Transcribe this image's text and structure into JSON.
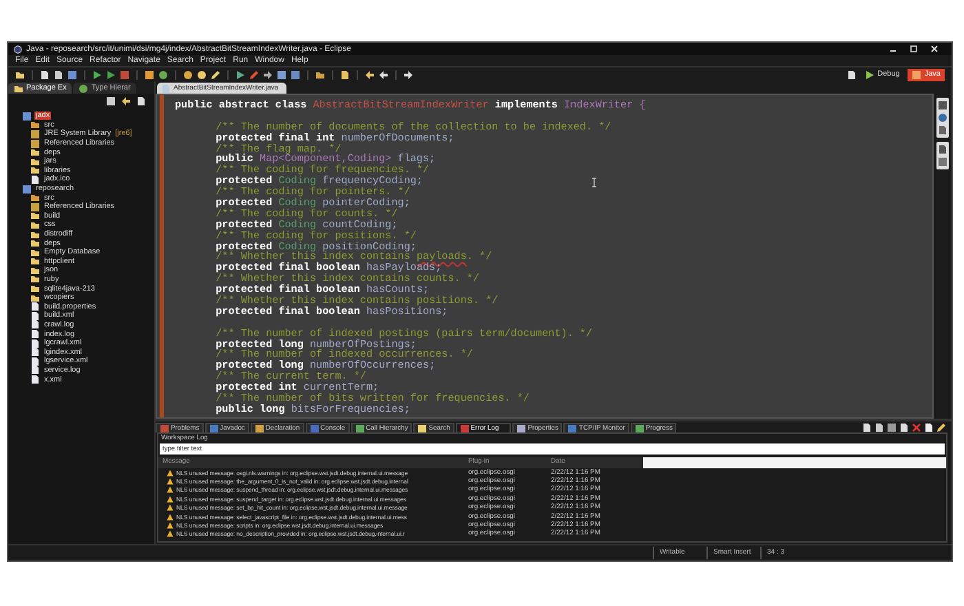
{
  "window": {
    "title": "Java - reposearch/src/it/unimi/dsi/mg4j/index/AbstractBitStreamIndexWriter.java - Eclipse"
  },
  "menu": [
    "File",
    "Edit",
    "Source",
    "Refactor",
    "Navigate",
    "Search",
    "Project",
    "Run",
    "Window",
    "Help"
  ],
  "perspectives": [
    {
      "label": "Debug",
      "selected": false
    },
    {
      "label": "Java",
      "selected": true
    }
  ],
  "left_tabs": [
    {
      "label": "Package Ex",
      "selected": true
    },
    {
      "label": "Type Hierar",
      "selected": false
    }
  ],
  "package_explorer": {
    "tree": [
      {
        "label": "jadx",
        "kind": "project",
        "selected": true,
        "children": [
          {
            "label": "src",
            "kind": "source",
            "selected": false
          },
          {
            "label": "JRE System Library",
            "decoration": "[jre6]",
            "kind": "library",
            "selected": false
          },
          {
            "label": "Referenced Libraries",
            "kind": "library",
            "selected": false
          },
          {
            "label": "deps",
            "kind": "folder",
            "selected": false
          },
          {
            "label": "jars",
            "kind": "folder",
            "selected": false
          },
          {
            "label": "libraries",
            "kind": "folder",
            "selected": false
          },
          {
            "label": "jadx.ico",
            "kind": "file",
            "selected": false
          }
        ]
      },
      {
        "label": "reposearch",
        "kind": "project",
        "selected": false,
        "children": [
          {
            "label": "src",
            "kind": "source",
            "selected": false
          },
          {
            "label": "Referenced Libraries",
            "kind": "library",
            "selected": false
          },
          {
            "label": "build",
            "kind": "folder",
            "selected": false
          },
          {
            "label": "css",
            "kind": "folder",
            "selected": false
          },
          {
            "label": "distrodiff",
            "kind": "folder",
            "selected": false
          },
          {
            "label": "deps",
            "kind": "folder",
            "selected": false
          },
          {
            "label": "Empty Database",
            "kind": "folder",
            "selected": false
          },
          {
            "label": "httpclient",
            "kind": "folder",
            "selected": false
          },
          {
            "label": "json",
            "kind": "folder",
            "selected": false
          },
          {
            "label": "ruby",
            "kind": "folder",
            "selected": false
          },
          {
            "label": "sqlite4java-213",
            "kind": "folder",
            "selected": false
          },
          {
            "label": "wcopiers",
            "kind": "folder",
            "selected": false
          },
          {
            "label": "build.properties",
            "kind": "file",
            "selected": false
          },
          {
            "label": "build.xml",
            "kind": "file",
            "selected": false
          },
          {
            "label": "crawl.log",
            "kind": "file",
            "selected": false
          },
          {
            "label": "index.log",
            "kind": "file",
            "selected": false
          },
          {
            "label": "lgcrawl.xml",
            "kind": "file",
            "selected": false
          },
          {
            "label": "lgindex.xml",
            "kind": "file",
            "selected": false
          },
          {
            "label": "lgservice.xml",
            "kind": "file",
            "selected": false
          },
          {
            "label": "service.log",
            "kind": "file",
            "selected": false
          },
          {
            "label": "x.xml",
            "kind": "file",
            "selected": false
          }
        ]
      }
    ]
  },
  "editor": {
    "tab": "AbstractBitStreamIndexWriter.java",
    "header": [
      {
        "kind": "keyword",
        "text": "public abstract class"
      },
      {
        "kind": "class",
        "text": "AbstractBitStreamIndexWriter"
      },
      {
        "kind": "keyword",
        "text": "implements"
      },
      {
        "kind": "generic",
        "text": "IndexWriter {"
      }
    ],
    "body": [
      {
        "kind": "code",
        "segments": [
          {
            "kind": "comment",
            "text": "/** The number of documents of the collection to be indexed. */"
          }
        ]
      },
      {
        "kind": "code",
        "segments": [
          {
            "kind": "keyword",
            "text": "protected final int"
          },
          {
            "kind": "field",
            "text": "numberOfDocuments;"
          }
        ]
      },
      {
        "kind": "code",
        "segments": [
          {
            "kind": "comment",
            "text": "/** The flag map. */"
          }
        ]
      },
      {
        "kind": "code",
        "segments": [
          {
            "kind": "keyword",
            "text": "public"
          },
          {
            "kind": "generic",
            "text": "Map<Component,Coding>"
          },
          {
            "kind": "field",
            "text": "flags;"
          }
        ]
      },
      {
        "kind": "code",
        "segments": [
          {
            "kind": "comment",
            "text": "/** The coding for frequencies. */"
          }
        ]
      },
      {
        "kind": "code",
        "segments": [
          {
            "kind": "keyword",
            "text": "protected"
          },
          {
            "kind": "type",
            "text": "Coding"
          },
          {
            "kind": "field",
            "text": "frequencyCoding;"
          }
        ]
      },
      {
        "kind": "code",
        "segments": [
          {
            "kind": "comment",
            "text": "/** The coding for pointers. */"
          }
        ]
      },
      {
        "kind": "code",
        "segments": [
          {
            "kind": "keyword",
            "text": "protected"
          },
          {
            "kind": "type",
            "text": "Coding"
          },
          {
            "kind": "field",
            "text": "pointerCoding;"
          }
        ]
      },
      {
        "kind": "code",
        "segments": [
          {
            "kind": "comment",
            "text": "/** The coding for counts. */"
          }
        ]
      },
      {
        "kind": "code",
        "segments": [
          {
            "kind": "keyword",
            "text": "protected"
          },
          {
            "kind": "type",
            "text": "Coding"
          },
          {
            "kind": "field",
            "text": "countCoding;"
          }
        ]
      },
      {
        "kind": "code",
        "segments": [
          {
            "kind": "comment",
            "text": "/** The coding for positions. */"
          }
        ]
      },
      {
        "kind": "code",
        "segments": [
          {
            "kind": "keyword",
            "text": "protected"
          },
          {
            "kind": "type",
            "text": "Coding"
          },
          {
            "kind": "field",
            "text": "positionCoding;"
          }
        ]
      },
      {
        "kind": "code",
        "segments": [
          {
            "kind": "comment",
            "text": "/** Whether this index contains"
          },
          {
            "kind": "misspelled",
            "text": "payloads"
          },
          {
            "kind": "comment",
            "text": ". */"
          }
        ]
      },
      {
        "kind": "code",
        "segments": [
          {
            "kind": "keyword",
            "text": "protected final boolean"
          },
          {
            "kind": "field",
            "text": "hasPayloads;"
          }
        ]
      },
      {
        "kind": "code",
        "segments": [
          {
            "kind": "comment",
            "text": "/** Whether this index contains counts. */"
          }
        ]
      },
      {
        "kind": "code",
        "segments": [
          {
            "kind": "keyword",
            "text": "protected final boolean"
          },
          {
            "kind": "field",
            "text": "hasCounts;"
          }
        ]
      },
      {
        "kind": "code",
        "segments": [
          {
            "kind": "comment",
            "text": "/** Whether this index contains positions. */"
          }
        ]
      },
      {
        "kind": "code",
        "segments": [
          {
            "kind": "keyword",
            "text": "protected final boolean"
          },
          {
            "kind": "field",
            "text": "hasPositions;"
          }
        ]
      },
      {
        "kind": "blank"
      },
      {
        "kind": "code",
        "segments": [
          {
            "kind": "comment",
            "text": "/** The number of indexed postings (pairs term/document). */"
          }
        ]
      },
      {
        "kind": "code",
        "segments": [
          {
            "kind": "keyword",
            "text": "protected long"
          },
          {
            "kind": "field",
            "text": "numberOfPostings;"
          }
        ]
      },
      {
        "kind": "code",
        "segments": [
          {
            "kind": "comment",
            "text": "/** The number of indexed occurrences. */"
          }
        ]
      },
      {
        "kind": "code",
        "segments": [
          {
            "kind": "keyword",
            "text": "protected long"
          },
          {
            "kind": "field",
            "text": "numberOfOccurrences;"
          }
        ]
      },
      {
        "kind": "code",
        "segments": [
          {
            "kind": "comment",
            "text": "/** The current term. */"
          }
        ]
      },
      {
        "kind": "code",
        "segments": [
          {
            "kind": "keyword",
            "text": "protected int"
          },
          {
            "kind": "field",
            "text": "currentTerm;"
          }
        ]
      },
      {
        "kind": "code",
        "segments": [
          {
            "kind": "comment",
            "text": "/** The number of bits written for frequencies. */"
          }
        ]
      },
      {
        "kind": "code",
        "segments": [
          {
            "kind": "keyword",
            "text": "public long"
          },
          {
            "kind": "field",
            "text": "bitsForFrequencies;"
          }
        ]
      }
    ]
  },
  "bottom_tabs": [
    {
      "label": "Problems",
      "selected": false
    },
    {
      "label": "Javadoc",
      "selected": false
    },
    {
      "label": "Declaration",
      "selected": false
    },
    {
      "label": "Console",
      "selected": false
    },
    {
      "label": "Call Hierarchy",
      "selected": false
    },
    {
      "label": "Search",
      "selected": false
    },
    {
      "label": "Error Log",
      "selected": true
    },
    {
      "label": "Properties",
      "selected": false
    },
    {
      "label": "TCP/IP Monitor",
      "selected": false
    },
    {
      "label": "Progress",
      "selected": false
    }
  ],
  "error_log": {
    "title": "Workspace Log",
    "filter": {
      "placeholder": "type filter text"
    },
    "columns": [
      "Message",
      "Plug-in",
      "Date"
    ],
    "rows": [
      {
        "message": "NLS unused message: osgi.nls.warnings in: org.eclipse.wst.jsdt.debug.internal.ui.message",
        "plugin": "org.eclipse.osgi",
        "date": "2/22/12 1:16 PM"
      },
      {
        "message": "NLS unused message: the_argument_0_is_not_valid in: org.eclipse.wst.jsdt.debug.internal",
        "plugin": "org.eclipse.osgi",
        "date": "2/22/12 1:16 PM"
      },
      {
        "message": "NLS unused message: suspend_thread in: org.eclipse.wst.jsdt.debug.internal.ui.messages",
        "plugin": "org.eclipse.osgi",
        "date": "2/22/12 1:16 PM"
      },
      {
        "message": "NLS unused message: suspend_target in: org.eclipse.wst.jsdt.debug.internal.ui.messages",
        "plugin": "org.eclipse.osgi",
        "date": "2/22/12 1:16 PM"
      },
      {
        "message": "NLS unused message: set_bp_hit_count in: org.eclipse.wst.jsdt.debug.internal.ui.message",
        "plugin": "org.eclipse.osgi",
        "date": "2/22/12 1:16 PM"
      },
      {
        "message": "NLS unused message: select_javascript_file in: org.eclipse.wst.jsdt.debug.internal.ui.mess",
        "plugin": "org.eclipse.osgi",
        "date": "2/22/12 1:16 PM"
      },
      {
        "message": "NLS unused message: scripts in: org.eclipse.wst.jsdt.debug.internal.ui.messages",
        "plugin": "org.eclipse.osgi",
        "date": "2/22/12 1:16 PM"
      },
      {
        "message": "NLS unused message: no_description_provided in: org.eclipse.wst.jsdt.debug.internal.ui.r",
        "plugin": "org.eclipse.osgi",
        "date": "2/22/12 1:16 PM"
      }
    ]
  },
  "status_bar": [
    "Writable",
    "Smart Insert",
    "34 : 3"
  ]
}
